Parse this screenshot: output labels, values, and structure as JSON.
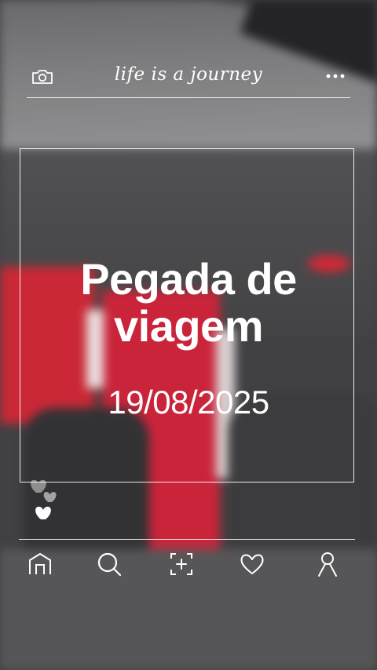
{
  "header": {
    "tagline": "life is a journey",
    "icons": [
      "camera-icon",
      "more-icon"
    ]
  },
  "post": {
    "title": "Pegada de viagem",
    "date": "19/08/2025"
  },
  "reactions": {
    "icons": [
      "heart-icon",
      "heart-icon",
      "heart-icon"
    ]
  },
  "nav": {
    "items": [
      "home-icon",
      "search-icon",
      "add-post-icon",
      "likes-icon",
      "profile-icon"
    ]
  },
  "colors": {
    "foreground": "#ffffff",
    "accent_red": "#c81c32"
  }
}
